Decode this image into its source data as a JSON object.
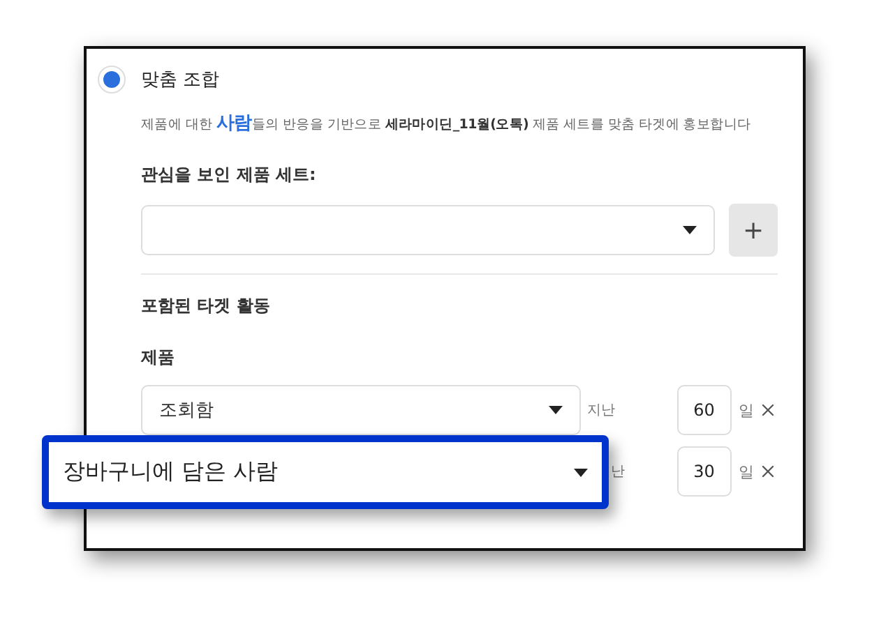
{
  "option": {
    "title": "맞춤 조합",
    "selected": true,
    "description": [
      {
        "kind": "plain",
        "text": "제품에 대한 "
      },
      {
        "kind": "highlight",
        "text": "사람"
      },
      {
        "kind": "plain",
        "text": "들의 반응을 기반으로 "
      },
      {
        "kind": "bold",
        "text": "세라마이딘_11월(오톡)"
      },
      {
        "kind": "plain",
        "text": " 제품 세트를 맞춤 타겟에 홍보합니다"
      }
    ]
  },
  "product_set": {
    "label": "관심을 보인 제품 세트:",
    "add_button": "+"
  },
  "section_title": "포함된 타겟 활동",
  "products_label": "제품",
  "rows": [
    {
      "select": "조회함",
      "since": "지난",
      "days": "60",
      "unit": "일"
    },
    {
      "since": "난",
      "days": "30",
      "unit": "일"
    }
  ],
  "callout": {
    "text": "장바구니에 담은 사람"
  }
}
